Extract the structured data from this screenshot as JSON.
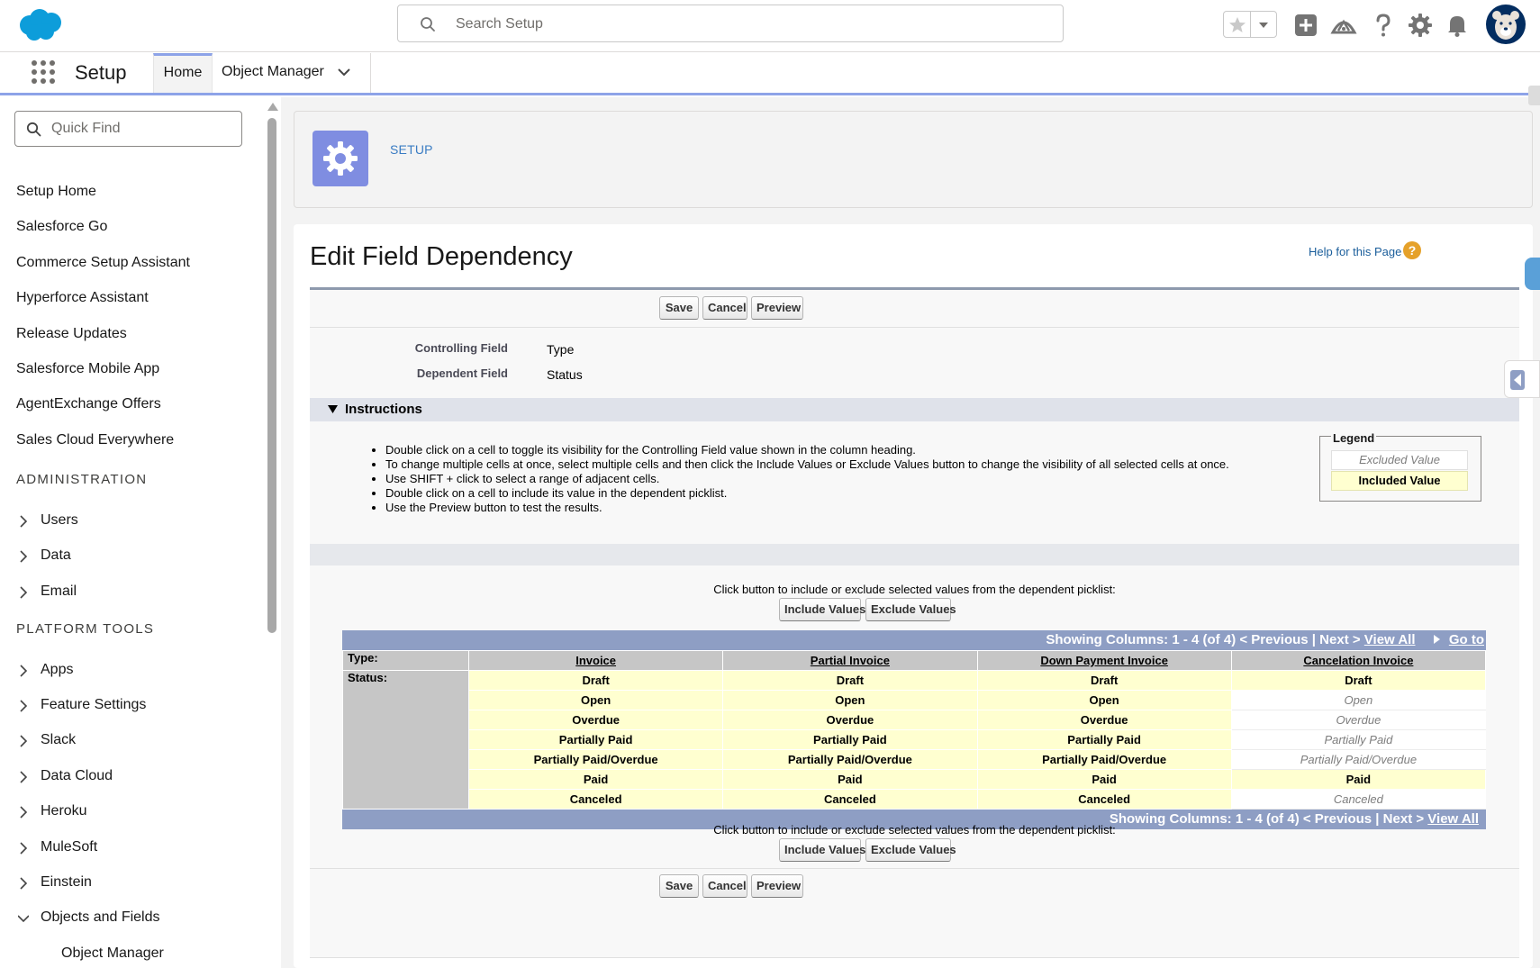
{
  "header": {
    "search_placeholder": "Search Setup"
  },
  "nav": {
    "app_name": "Setup",
    "tabs": [
      {
        "label": "Home"
      },
      {
        "label": "Object Manager"
      }
    ]
  },
  "sidebar": {
    "quick_find_placeholder": "Quick Find",
    "links": [
      "Setup Home",
      "Salesforce Go",
      "Commerce Setup Assistant",
      "Hyperforce Assistant",
      "Release Updates",
      "Salesforce Mobile App",
      "AgentExchange Offers",
      "Sales Cloud Everywhere"
    ],
    "sections": [
      "ADMINISTRATION",
      "PLATFORM TOOLS"
    ],
    "admin_items": [
      "Users",
      "Data",
      "Email"
    ],
    "platform_items": [
      "Apps",
      "Feature Settings",
      "Slack",
      "Data Cloud",
      "Heroku",
      "MuleSoft",
      "Einstein",
      "Objects and Fields"
    ],
    "sub_items": [
      "Object Manager"
    ]
  },
  "setup_header": {
    "label": "SETUP"
  },
  "page": {
    "title": "Edit Field Dependency",
    "help_link": "Help for this Page",
    "help_icon_glyph": "?",
    "buttons": {
      "save": "Save",
      "cancel": "Cancel",
      "preview": "Preview"
    },
    "fields": {
      "controlling_label": "Controlling Field",
      "controlling_value": "Type",
      "dependent_label": "Dependent Field",
      "dependent_value": "Status"
    },
    "instructions_title": "Instructions",
    "instructions": [
      "Double click on a cell to toggle its visibility for the Controlling Field value shown in the column heading.",
      "To change multiple cells at once, select multiple cells and then click the Include Values or Exclude Values button to change the visibility of all selected cells at once.",
      "Use SHIFT + click to select a range of adjacent cells.",
      "Double click on a cell to include its value in the dependent picklist.",
      "Use the Preview button to test the results."
    ],
    "legend": {
      "title": "Legend",
      "excluded": "Excluded Value",
      "included": "Included Value"
    },
    "click_text": "Click button to include or exclude selected values from the dependent picklist:",
    "include_button": "Include Values",
    "exclude_button": "Exclude Values"
  },
  "matrix": {
    "pager_top": {
      "text": "Showing Columns: 1 - 4 (of 4) < Previous | Next > ",
      "view_all": "View All",
      "go_to": "Go to"
    },
    "pager_bottom": {
      "text": "Showing Columns: 1 - 4 (of 4) < Previous | Next > ",
      "view_all": "View All"
    },
    "type_label": "Type:",
    "status_label": "Status:",
    "columns": [
      "Invoice",
      "Partial Invoice",
      "Down Payment Invoice",
      "Cancelation Invoice"
    ],
    "rows": [
      "Draft",
      "Open",
      "Overdue",
      "Partially Paid",
      "Partially Paid/Overdue",
      "Paid",
      "Canceled"
    ],
    "included": [
      [
        true,
        true,
        true,
        true
      ],
      [
        true,
        true,
        true,
        false
      ],
      [
        true,
        true,
        true,
        false
      ],
      [
        true,
        true,
        true,
        false
      ],
      [
        true,
        true,
        true,
        false
      ],
      [
        true,
        true,
        true,
        true
      ],
      [
        true,
        true,
        true,
        false
      ]
    ]
  },
  "colors": {
    "brand_blue": "#0176d3",
    "setup_icon": "#7f8de1",
    "included_cell": "#ffffd0",
    "pager_bar": "#8e9ec4"
  }
}
